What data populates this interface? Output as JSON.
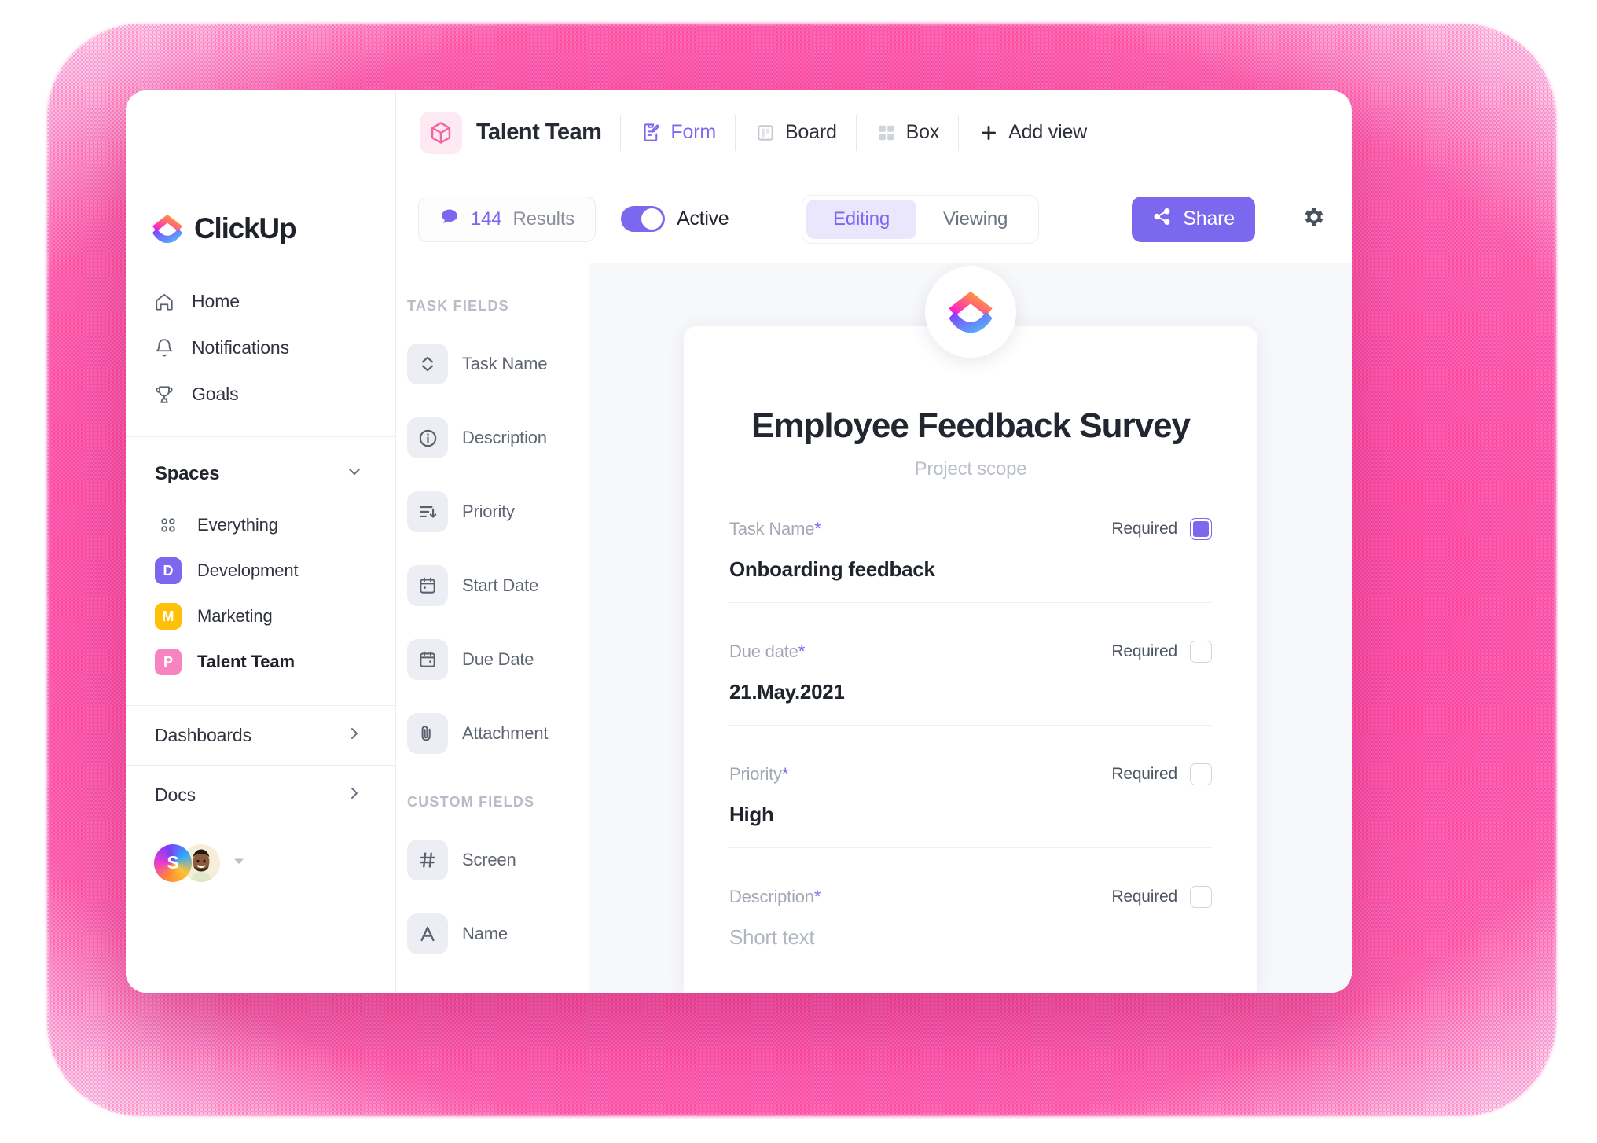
{
  "theme": {
    "accent": "#7b68ee",
    "accent_soft": "#eae7fd",
    "backdrop_pink": "#ff59ad",
    "canvas_bg": "#f7f8fa",
    "space_talent_pink": "#f783c0",
    "space_dev_purple": "#7b68ee",
    "space_marketing_yellow": "#ffc107"
  },
  "sidebar": {
    "brand": "ClickUp",
    "nav": [
      {
        "icon": "home-icon",
        "label": "Home"
      },
      {
        "icon": "bell-icon",
        "label": "Notifications"
      },
      {
        "icon": "trophy-icon",
        "label": "Goals"
      }
    ],
    "spaces_header": "Spaces",
    "spaces": [
      {
        "type": "all",
        "badge": "",
        "label": "Everything",
        "color": ""
      },
      {
        "type": "space",
        "badge": "D",
        "label": "Development",
        "color": "#7b68ee"
      },
      {
        "type": "space",
        "badge": "M",
        "label": "Marketing",
        "color": "#ffc107"
      },
      {
        "type": "space",
        "badge": "P",
        "label": "Talent Team",
        "color": "#f783c0"
      }
    ],
    "sections": [
      {
        "label": "Dashboards"
      },
      {
        "label": "Docs"
      }
    ],
    "avatars": [
      {
        "initial": "S",
        "kind": "gradient"
      },
      {
        "initial": "",
        "kind": "photo"
      }
    ]
  },
  "topbar": {
    "space_icon": "cube-icon",
    "space_title": "Talent Team",
    "views": [
      {
        "icon": "form-icon",
        "label": "Form",
        "active": true
      },
      {
        "icon": "board-icon",
        "label": "Board",
        "active": false
      },
      {
        "icon": "box-icon",
        "label": "Box",
        "active": false
      }
    ],
    "add_view_label": "Add view",
    "add_view_icon": "plus-icon"
  },
  "toolbar": {
    "results_count": "144",
    "results_label": "Results",
    "results_icon": "comment-icon",
    "toggle_label": "Active",
    "toggle_on": true,
    "modes": [
      {
        "label": "Editing",
        "active": true
      },
      {
        "label": "Viewing",
        "active": false
      }
    ],
    "share_label": "Share",
    "share_icon": "share-icon",
    "settings_icon": "gear-icon"
  },
  "fields_panel": {
    "task_fields_title": "TASK FIELDS",
    "task_fields": [
      {
        "icon": "task-name-icon",
        "label": "Task Name"
      },
      {
        "icon": "info-icon",
        "label": "Description"
      },
      {
        "icon": "priority-icon",
        "label": "Priority"
      },
      {
        "icon": "calendar-start-icon",
        "label": "Start Date"
      },
      {
        "icon": "calendar-due-icon",
        "label": "Due Date"
      },
      {
        "icon": "paperclip-icon",
        "label": "Attachment"
      }
    ],
    "custom_fields_title": "CUSTOM FIELDS",
    "custom_fields": [
      {
        "icon": "hash-icon",
        "label": "Screen"
      },
      {
        "icon": "letter-a-icon",
        "label": "Name"
      }
    ]
  },
  "form": {
    "logo_icon": "clickup-logo-icon",
    "title": "Employee Feedback Survey",
    "subtitle": "Project scope",
    "required_label": "Required",
    "fields": [
      {
        "label": "Task Name",
        "star": "*",
        "value": "Onboarding feedback",
        "is_placeholder": false,
        "required_checked": true
      },
      {
        "label": "Due date",
        "star": "*",
        "value": "21.May.2021",
        "is_placeholder": false,
        "required_checked": false
      },
      {
        "label": "Priority",
        "star": "*",
        "value": "High",
        "is_placeholder": false,
        "required_checked": false
      },
      {
        "label": "Description",
        "star": "*",
        "value": "Short text",
        "is_placeholder": true,
        "required_checked": false
      }
    ]
  }
}
